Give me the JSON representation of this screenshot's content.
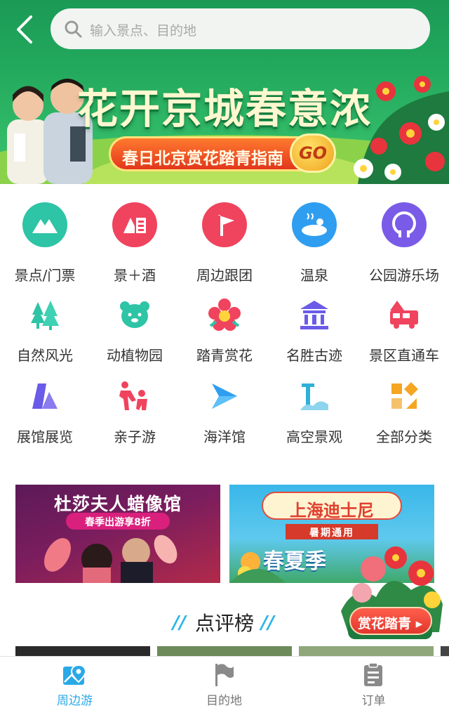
{
  "header": {
    "search_placeholder": "输入景点、目的地"
  },
  "hero": {
    "title": "花开京城春意浓",
    "pill_text": "春日北京赏花踏青指南",
    "go_label": "GO"
  },
  "categories": [
    {
      "label": "景点/门票",
      "icon": "mountain-icon",
      "color": "#2ec4a6"
    },
    {
      "label": "景＋酒",
      "icon": "hotel-icon",
      "color": "#f0435e"
    },
    {
      "label": "周边跟团",
      "icon": "flag-icon",
      "color": "#f0435e"
    },
    {
      "label": "温泉",
      "icon": "hot-spring-icon",
      "color": "#2f9ef0"
    },
    {
      "label": "公园游乐场",
      "icon": "ferris-wheel-icon",
      "color": "#7a5be8"
    },
    {
      "label": "自然风光",
      "icon": "trees-icon",
      "color": "#2ec4a6"
    },
    {
      "label": "动植物园",
      "icon": "bear-icon",
      "color": "#2ec4a6"
    },
    {
      "label": "踏青赏花",
      "icon": "flower-icon",
      "color": "#f0435e"
    },
    {
      "label": "名胜古迹",
      "icon": "temple-icon",
      "color": "#6a5be8"
    },
    {
      "label": "景区直通车",
      "icon": "bus-icon",
      "color": "#f0435e"
    },
    {
      "label": "展馆展览",
      "icon": "museum-icon",
      "color": "#6a5be8"
    },
    {
      "label": "亲子游",
      "icon": "family-icon",
      "color": "#f0435e"
    },
    {
      "label": "海洋馆",
      "icon": "fish-icon",
      "color": "#2f9ef0"
    },
    {
      "label": "高空景观",
      "icon": "tower-icon",
      "color": "#2fb0d8"
    },
    {
      "label": "全部分类",
      "icon": "grid-icon",
      "color": "#f5a623"
    }
  ],
  "promos": {
    "left": {
      "title": "杜莎夫人蜡像馆",
      "badge": "春季出游享8折"
    },
    "right": {
      "title": "上海迪士尼",
      "ribbon": "暑期通用",
      "subtitle": "春夏季"
    }
  },
  "float_badge": {
    "label": "赏花踏青",
    "arrow": "▸"
  },
  "ranking": {
    "title": "点评榜"
  },
  "tabs": [
    {
      "label": "周边游",
      "icon": "map-pin-icon",
      "active": true
    },
    {
      "label": "目的地",
      "icon": "flag-icon",
      "active": false
    },
    {
      "label": "订单",
      "icon": "clipboard-icon",
      "active": false
    }
  ],
  "colors": {
    "accent": "#2aa9e6",
    "hero_green": "#22a85d",
    "hero_title": "#fff7d0",
    "pill_orange": "#e2371d"
  }
}
